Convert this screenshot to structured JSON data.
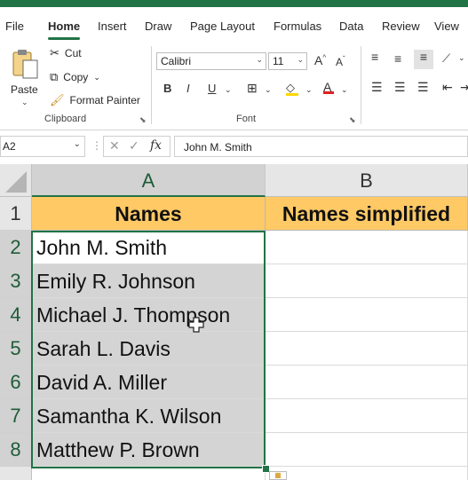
{
  "menu": [
    "File",
    "Home",
    "Insert",
    "Draw",
    "Page Layout",
    "Formulas",
    "Data",
    "Review",
    "View"
  ],
  "active_tab": "Home",
  "ribbon": {
    "clipboard": {
      "paste": "Paste",
      "cut": "Cut",
      "copy": "Copy",
      "format_painter": "Format Painter",
      "label": "Clipboard"
    },
    "font": {
      "name": "Calibri",
      "size": "11",
      "label": "Font"
    }
  },
  "formula_bar": {
    "name_box": "A2",
    "fx": "fx",
    "value": "John M. Smith"
  },
  "sheet": {
    "columns": [
      "A",
      "B"
    ],
    "rows": [
      "1",
      "2",
      "3",
      "4",
      "5",
      "6",
      "7",
      "8"
    ],
    "header": [
      "Names",
      "Names simplified"
    ],
    "names": [
      "John M. Smith",
      "Emily R. Johnson",
      "Michael J. Thompson",
      "Sarah L. Davis",
      "David A. Miller",
      "Samantha K. Wilson",
      "Matthew P. Brown"
    ]
  },
  "colors": {
    "accent": "#217346",
    "header_fill": "#ffc965",
    "selection": "#d4d4d4"
  }
}
